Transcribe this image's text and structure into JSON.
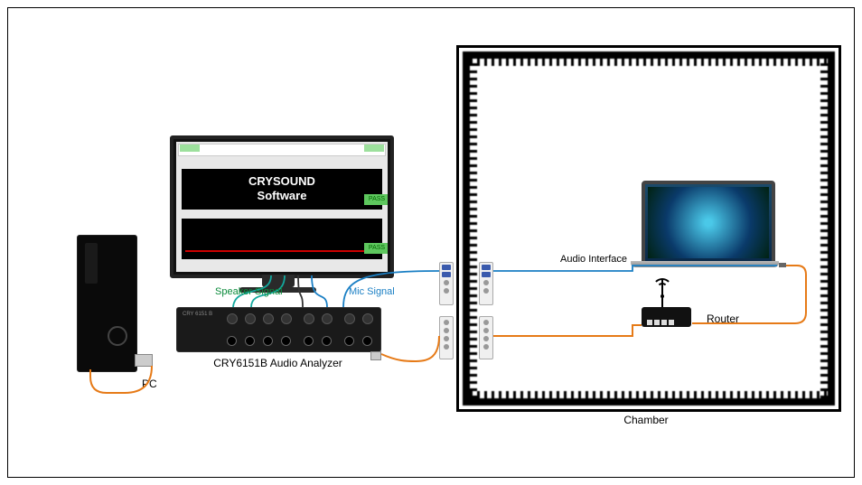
{
  "labels": {
    "pc": "PC",
    "analyzer": "CRY6151B Audio Analyzer",
    "chamber": "Chamber",
    "router": "Router",
    "audio_interface": "Audio Interface",
    "speaker_signal": "Speaker Signal",
    "mic_signal": "Mic Signal"
  },
  "monitor": {
    "software_line1": "CRYSOUND",
    "software_line2": "Software",
    "pass1": "PASS",
    "pass2": "PASS"
  },
  "analyzer_brand": "CRY 6151 B",
  "colors": {
    "orange_cable": "#e67a17",
    "blue_cable": "#1a7fc4",
    "teal_cable": "#14a89e",
    "dark_cable": "#333333",
    "pass_green": "#5ec75e"
  },
  "components": [
    {
      "name": "PC",
      "type": "desktop-computer"
    },
    {
      "name": "Monitor",
      "type": "display",
      "shows": "CRYSOUND Software"
    },
    {
      "name": "CRY6151B Audio Analyzer",
      "type": "audio-analyzer"
    },
    {
      "name": "Panel connectors",
      "type": "feedthrough-panel",
      "count": 4
    },
    {
      "name": "Chamber",
      "type": "anechoic-chamber"
    },
    {
      "name": "Laptop",
      "type": "laptop-dut"
    },
    {
      "name": "Router",
      "type": "wifi-router"
    }
  ],
  "connections": [
    {
      "from": "PC",
      "to": "CRY6151B Audio Analyzer",
      "cable": "orange",
      "count": 1
    },
    {
      "from": "Monitor",
      "to": "CRY6151B Audio Analyzer",
      "cable": "teal",
      "label": "Speaker Signal",
      "count": 2
    },
    {
      "from": "Monitor",
      "to": "CRY6151B Audio Analyzer",
      "cable": "blue",
      "label": "Mic Signal",
      "count": 1
    },
    {
      "from": "CRY6151B Audio Analyzer",
      "to": "Panel (outer top)",
      "cable": "blue",
      "label": "Mic Signal"
    },
    {
      "from": "Panel (inner top)",
      "to": "Laptop",
      "cable": "blue",
      "label": "Audio Interface"
    },
    {
      "from": "CRY6151B Audio Analyzer",
      "to": "Panel (outer bottom)",
      "cable": "orange"
    },
    {
      "from": "Panel (inner bottom)",
      "to": "Router",
      "cable": "orange"
    },
    {
      "from": "Router",
      "to": "Laptop",
      "cable": "orange"
    }
  ]
}
